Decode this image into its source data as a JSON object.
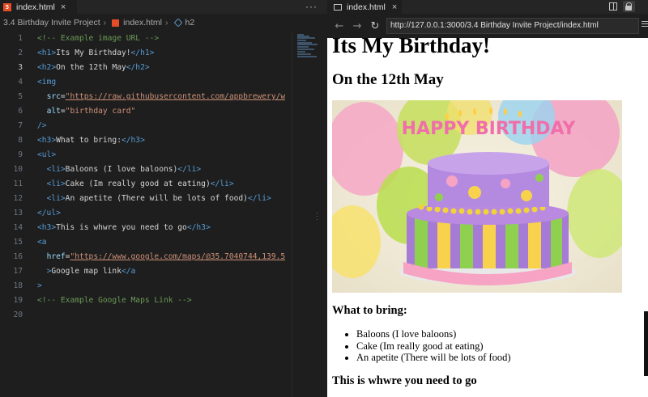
{
  "editor": {
    "tab": {
      "label": "index.html",
      "close": "×"
    },
    "more": "···",
    "breadcrumb": [
      "3.4 Birthday Invite Project",
      "index.html",
      "h2"
    ],
    "lines": [
      {
        "num": "1",
        "tokens": [
          [
            "cm",
            "<!-- Example image URL -->"
          ]
        ]
      },
      {
        "num": "2",
        "tokens": [
          [
            "t",
            "<h1>"
          ],
          [
            "tx",
            "Its My Birthday!"
          ],
          [
            "t",
            "</h1>"
          ]
        ]
      },
      {
        "num": "3",
        "tokens": [
          [
            "t",
            "<h2>"
          ],
          [
            "tx",
            "On the 12th May"
          ],
          [
            "t",
            "</h2>"
          ]
        ]
      },
      {
        "num": "4",
        "tokens": [
          [
            "t",
            "<img"
          ]
        ]
      },
      {
        "num": "5",
        "tokens": [
          [
            "tx",
            "  "
          ],
          [
            "at",
            "src"
          ],
          [
            "tx",
            "="
          ],
          [
            "st",
            "\"https://raw.githubusercontent.com/appbrewery/w"
          ]
        ]
      },
      {
        "num": "6",
        "tokens": [
          [
            "tx",
            "  "
          ],
          [
            "at",
            "alt"
          ],
          [
            "tx",
            "="
          ],
          [
            "st",
            "\"birthday card\""
          ]
        ]
      },
      {
        "num": "7",
        "tokens": [
          [
            "t",
            "/>"
          ]
        ]
      },
      {
        "num": "8",
        "tokens": [
          [
            "t",
            "<h3>"
          ],
          [
            "tx",
            "What to bring:"
          ],
          [
            "t",
            "</h3>"
          ]
        ]
      },
      {
        "num": "9",
        "tokens": [
          [
            "t",
            "<ul>"
          ]
        ]
      },
      {
        "num": "10",
        "tokens": [
          [
            "tx",
            "  "
          ],
          [
            "t",
            "<li>"
          ],
          [
            "tx",
            "Baloons (I love baloons)"
          ],
          [
            "t",
            "</li>"
          ]
        ]
      },
      {
        "num": "11",
        "tokens": [
          [
            "tx",
            "  "
          ],
          [
            "t",
            "<li>"
          ],
          [
            "tx",
            "Cake (Im really good at eating)"
          ],
          [
            "t",
            "</li>"
          ]
        ]
      },
      {
        "num": "12",
        "tokens": [
          [
            "tx",
            "  "
          ],
          [
            "t",
            "<li>"
          ],
          [
            "tx",
            "An apetite (There will be lots of food)"
          ],
          [
            "t",
            "</li>"
          ]
        ]
      },
      {
        "num": "13",
        "tokens": [
          [
            "t",
            "</ul>"
          ]
        ]
      },
      {
        "num": "14",
        "tokens": [
          [
            "t",
            "<h3>"
          ],
          [
            "tx",
            "This is whwre you need to go"
          ],
          [
            "t",
            "</h3>"
          ]
        ]
      },
      {
        "num": "15",
        "tokens": [
          [
            "t",
            "<a"
          ]
        ]
      },
      {
        "num": "16",
        "tokens": [
          [
            "tx",
            "  "
          ],
          [
            "at",
            "href"
          ],
          [
            "tx",
            "="
          ],
          [
            "st",
            "\"https://www.google.com/maps/@35.7040744,139.5"
          ]
        ]
      },
      {
        "num": "17",
        "tokens": [
          [
            "tx",
            "  "
          ],
          [
            "t",
            ">"
          ],
          [
            "tx",
            "Google map link"
          ],
          [
            "t",
            "</a"
          ]
        ]
      },
      {
        "num": "18",
        "tokens": [
          [
            "t",
            ">"
          ]
        ]
      },
      {
        "num": "19",
        "tokens": [
          [
            "cm",
            "<!-- Example Google Maps Link -->"
          ]
        ]
      },
      {
        "num": "20",
        "tokens": []
      }
    ],
    "active_line": "3"
  },
  "browser": {
    "tab": {
      "label": "index.html",
      "close": "×"
    },
    "nav": {
      "back": "←",
      "forward": "→",
      "reload": "↻"
    },
    "url": "http://127.0.0.1:3000/3.4 Birthday Invite Project/index.html",
    "page": {
      "h1": "Its My Birthday!",
      "h2": "On the 12th May",
      "img_alt": "birthday card",
      "cake_text": "HAPPY BIRTHDAY",
      "h3_bring": "What to bring:",
      "items": [
        "Baloons (I love baloons)",
        "Cake (Im really good at eating)",
        "An apetite (There will be lots of food)"
      ],
      "h3_where": "This is whwre you need to go"
    }
  }
}
